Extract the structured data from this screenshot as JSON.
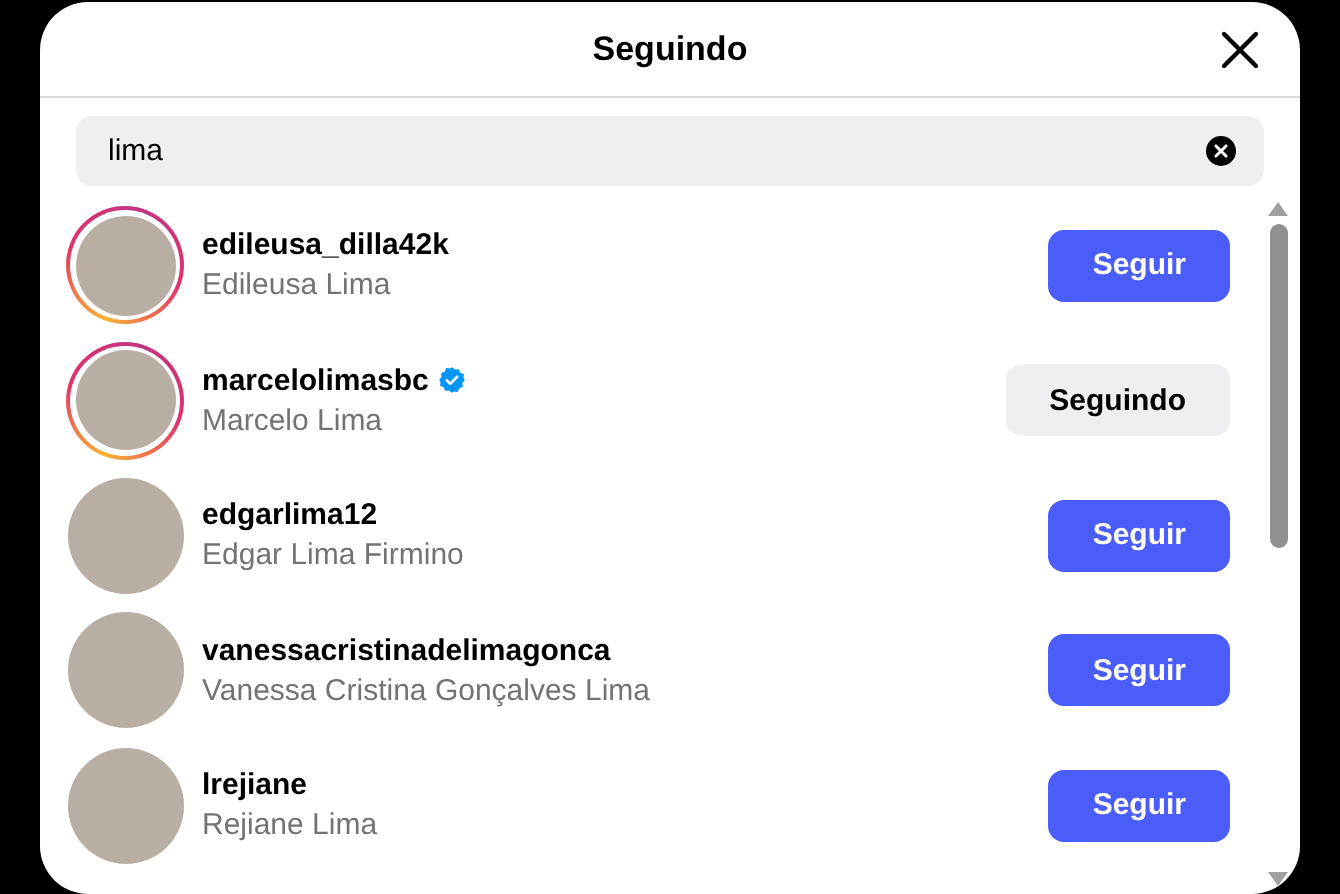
{
  "dialog": {
    "title": "Seguindo"
  },
  "search": {
    "value": "lima"
  },
  "users": [
    {
      "username": "edileusa_dilla42k",
      "full_name": "Edileusa Lima",
      "verified": false,
      "story": true,
      "following": false,
      "button": "Seguir"
    },
    {
      "username": "marcelolimasbc",
      "full_name": "Marcelo Lima",
      "verified": true,
      "story": true,
      "following": true,
      "button": "Seguindo"
    },
    {
      "username": "edgarlima12",
      "full_name": "Edgar Lima Firmino",
      "verified": false,
      "story": false,
      "following": false,
      "button": "Seguir"
    },
    {
      "username": "vanessacristinadelimagonca",
      "full_name": "Vanessa Cristina Gonçalves Lima",
      "verified": false,
      "story": false,
      "following": false,
      "button": "Seguir"
    },
    {
      "username": "lrejiane",
      "full_name": "Rejiane Lima",
      "verified": false,
      "story": false,
      "following": false,
      "button": "Seguir"
    }
  ]
}
